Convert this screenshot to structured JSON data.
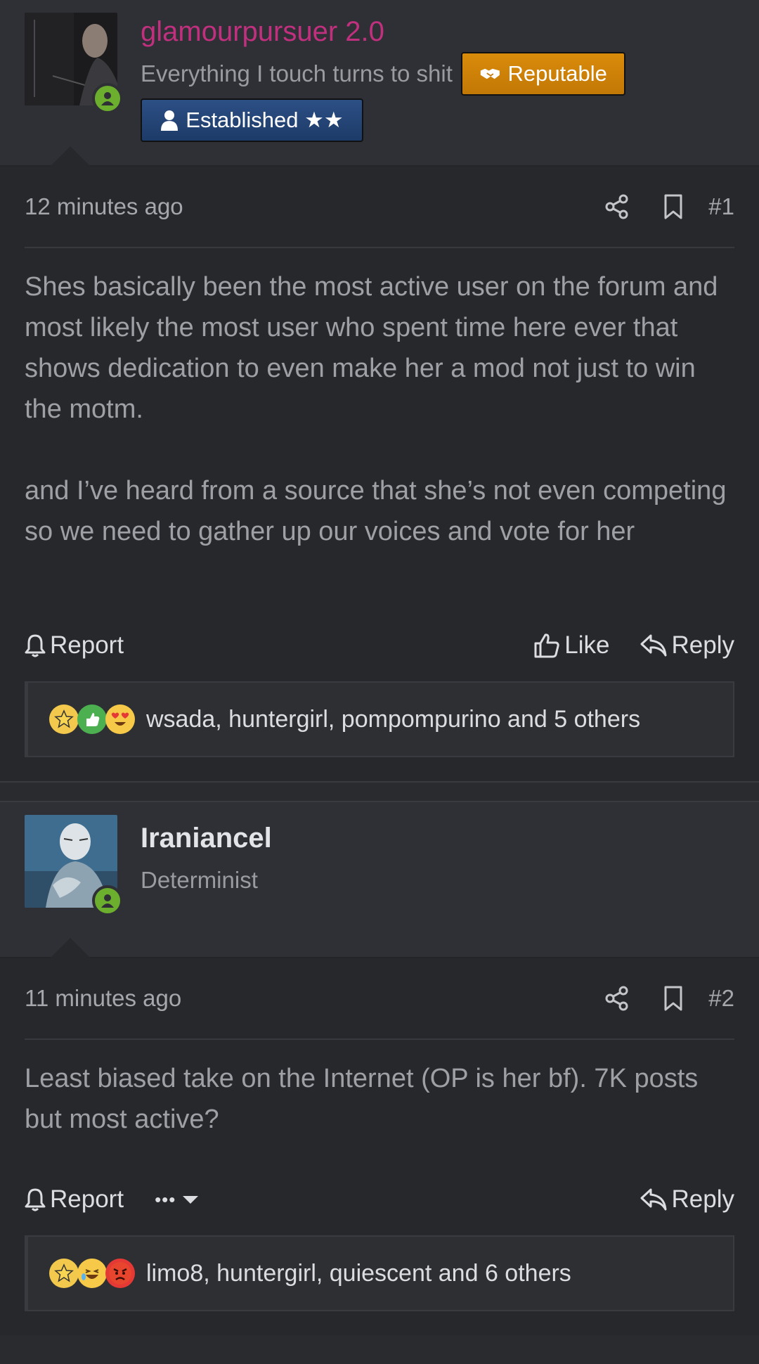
{
  "posts": [
    {
      "username": "glamourpursuer 2.0",
      "user_title": "Everything I touch turns to shit",
      "badges": {
        "reputable": "Reputable",
        "established": "Established ★★"
      },
      "time": "12 minutes ago",
      "post_number": "#1",
      "message": "Shes basically been the most active user on the forum and most likely the most user who spent time here ever that shows dedication to even make her a mod not just to win the motm.\n\nand I’ve heard from a source that she’s not even competing so we need to gather up our voices and vote for her",
      "actions": {
        "report": "Report",
        "like": "Like",
        "reply": "Reply"
      },
      "reactions_text": "wsada, huntergirl, pompompurino and 5 others"
    },
    {
      "username": "Iraniancel",
      "user_title": "Determinist",
      "time": "11 minutes ago",
      "post_number": "#2",
      "message": "Least biased take on the Internet (OP is her bf). 7K posts but most active?",
      "actions": {
        "report": "Report",
        "more": "•••",
        "reply": "Reply"
      },
      "reactions_text": "limo8, huntergirl, quiescent and 6 others"
    }
  ],
  "colors": {
    "background": "#27282c",
    "header_background": "#2f3035",
    "username_pink": "#c0307e",
    "reputable_badge": "#d98b0a",
    "established_badge": "#2c4f85",
    "online_green": "#6cae2d"
  }
}
